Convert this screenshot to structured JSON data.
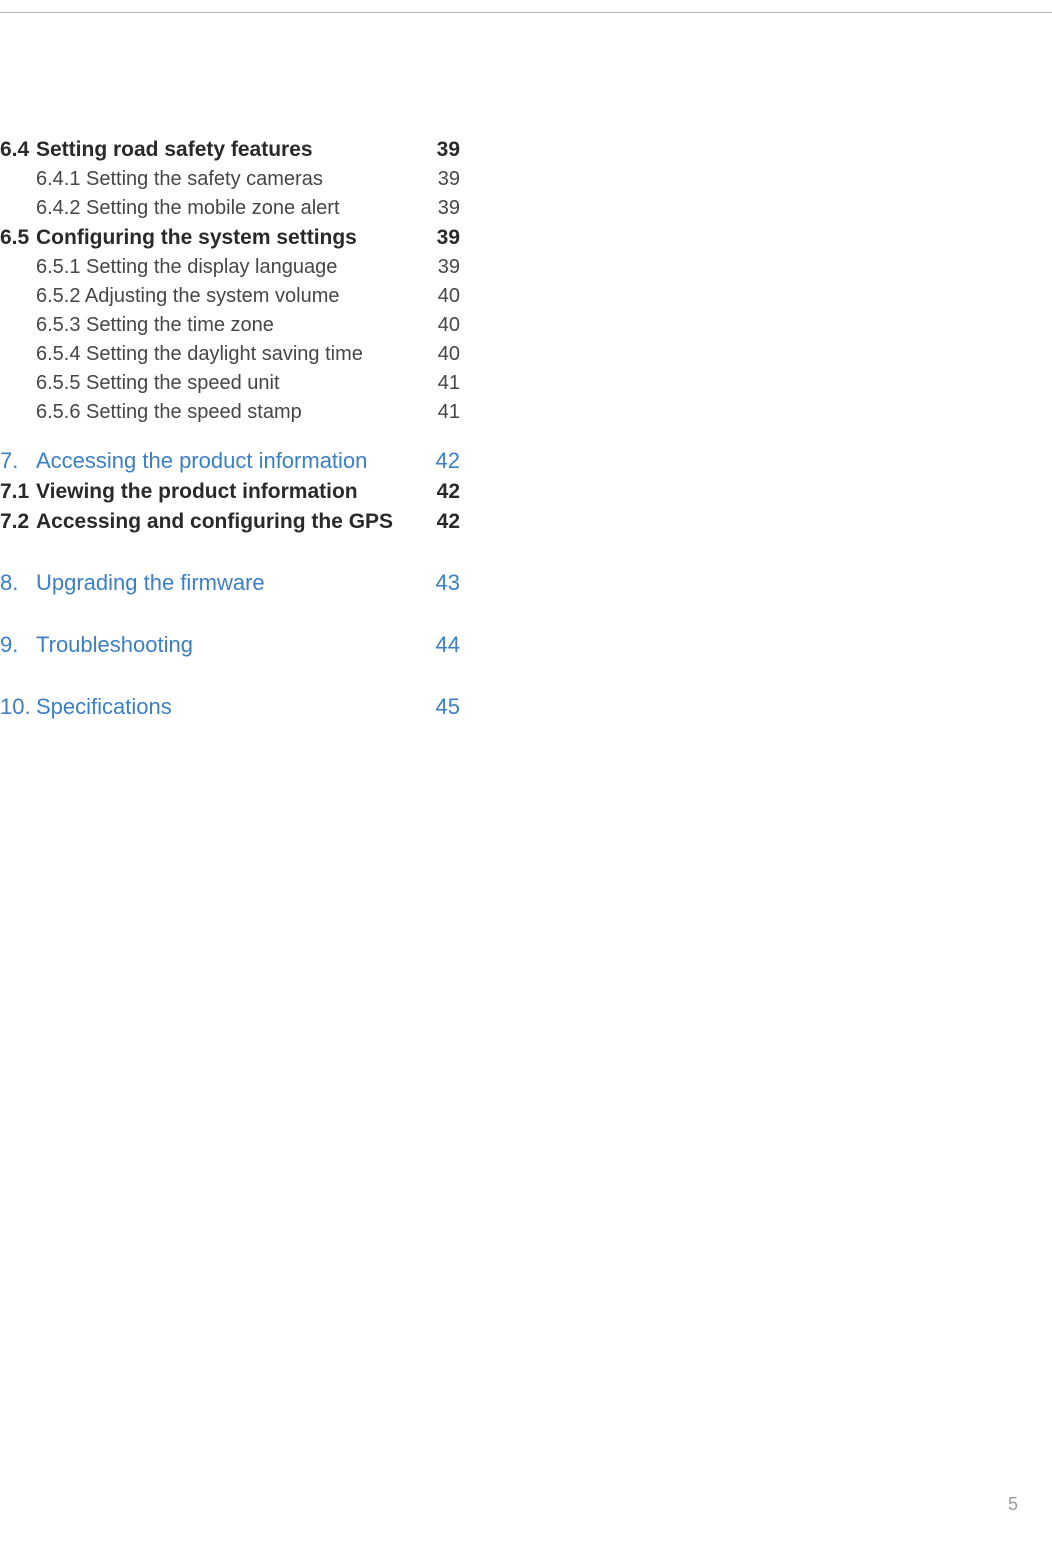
{
  "toc": [
    {
      "style": "sec2",
      "num": "6.4",
      "title": "Setting road safety features",
      "page": "39"
    },
    {
      "style": "sub",
      "num": "",
      "title": "6.4.1 Setting the safety cameras",
      "page": "39"
    },
    {
      "style": "sub",
      "num": "",
      "title": "6.4.2 Setting the mobile zone alert",
      "page": "39"
    },
    {
      "style": "sec2",
      "num": "6.5",
      "title": "Configuring the system settings",
      "page": "39"
    },
    {
      "style": "sub",
      "num": "",
      "title": "6.5.1 Setting the display language",
      "page": "39"
    },
    {
      "style": "sub",
      "num": "",
      "title": "6.5.2 Adjusting the system volume",
      "page": "40"
    },
    {
      "style": "sub",
      "num": "",
      "title": "6.5.3 Setting the time zone",
      "page": "40"
    },
    {
      "style": "sub",
      "num": "",
      "title": "6.5.4 Setting the daylight saving time",
      "page": "40"
    },
    {
      "style": "sub",
      "num": "",
      "title": "6.5.5 Setting the speed unit",
      "page": "41"
    },
    {
      "style": "sub",
      "num": "",
      "title": "6.5.6 Setting the speed stamp",
      "page": "41"
    },
    {
      "style": "gap-md"
    },
    {
      "style": "chap",
      "num": "7.",
      "title": "Accessing the product information",
      "page": "42"
    },
    {
      "style": "sec2",
      "num": "7.1",
      "title": "Viewing the product information",
      "page": "42"
    },
    {
      "style": "sec2",
      "num": "7.2",
      "title": "Accessing and configuring the GPS",
      "page": "42"
    },
    {
      "style": "gap-lg"
    },
    {
      "style": "chap",
      "num": "8.",
      "title": "Upgrading the firmware",
      "page": "43"
    },
    {
      "style": "gap-lg"
    },
    {
      "style": "chap",
      "num": "9.",
      "title": "Troubleshooting",
      "page": "44"
    },
    {
      "style": "gap-lg"
    },
    {
      "style": "chap",
      "num": "10.",
      "title": "Specifications",
      "page": "45"
    }
  ],
  "footer_page": "5"
}
